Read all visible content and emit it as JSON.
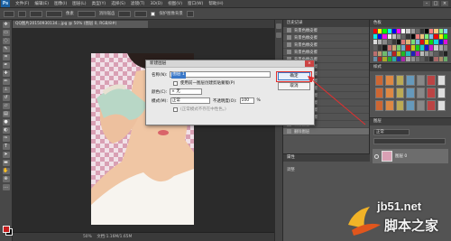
{
  "app": {
    "logo": "Ps",
    "menu": [
      "文件(F)",
      "编辑(E)",
      "图像(I)",
      "图层(L)",
      "类型(Y)",
      "选择(S)",
      "滤镜(T)",
      "3D(D)",
      "视图(V)",
      "窗口(W)",
      "帮助(H)"
    ]
  },
  "options_bar": {
    "option_label": "像素",
    "smooth_label": "消除锯齿",
    "protect_label": "保护图像背景"
  },
  "document": {
    "tab_title": "QQ图片20150930134...jpg @ 50% (图层 0, RGB/8#)",
    "status_zoom": "50%",
    "status_doc": "文档:1.16M/1.65M"
  },
  "history_panel": {
    "title": "历史记录",
    "items": [
      "背景色橡皮擦",
      "背景色橡皮擦",
      "背景色橡皮擦",
      "背景色橡皮擦",
      "背景色橡皮擦",
      "背景色橡皮擦",
      "背景色橡皮擦",
      "背景色橡皮擦",
      "背景色橡皮擦",
      "背景色橡皮擦",
      "背景色橡皮擦",
      "背景色橡皮擦",
      "背景色橡皮擦",
      "新建图层",
      "删除图层"
    ]
  },
  "swatches_panel": {
    "title": "色板"
  },
  "styles_panel": {
    "title": "样式"
  },
  "layers_panel": {
    "title": "图层",
    "blend_mode": "正常",
    "layer_name": "图层 0"
  },
  "properties_panel": {
    "title": "属性",
    "label": "调整"
  },
  "dialog": {
    "title": "新建图层",
    "name_label": "名称(N):",
    "name_value": "图层 1",
    "clip_label": "使用前一图层创建剪贴蒙版(P)",
    "color_label": "颜色(C):",
    "color_value": "× 无",
    "mode_label": "模式(M):",
    "mode_value": "正常",
    "opacity_label": "不透明度(O):",
    "opacity_value": "100",
    "opacity_unit": "%",
    "fill_label": "(正常模式不存在中性色。)",
    "ok_label": "确定",
    "cancel_label": "取消"
  },
  "watermark": {
    "brand": "jb51.net",
    "site": "脚本之家"
  },
  "colors": {
    "accent": "#3a78c8",
    "annotation_red": "#e03030",
    "foreground": "#c81e1e",
    "background": "#000000"
  }
}
